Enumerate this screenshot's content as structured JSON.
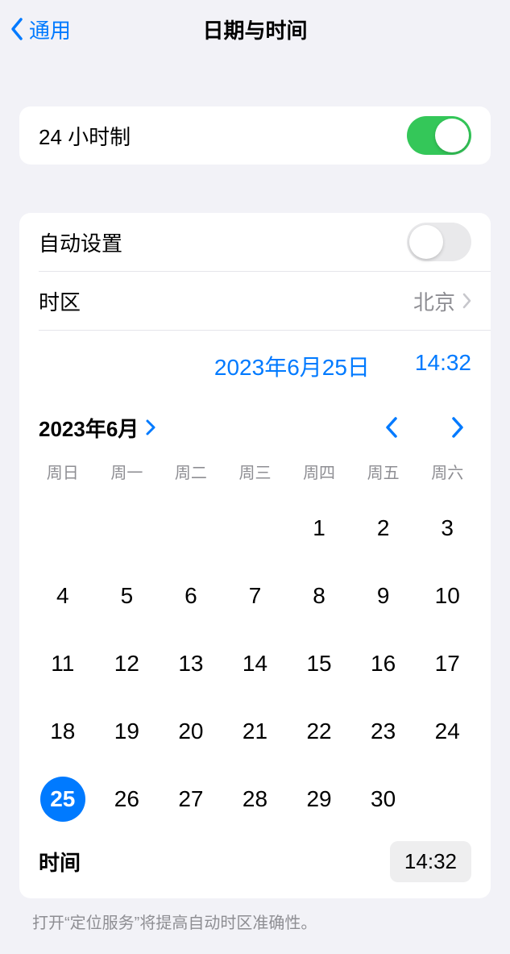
{
  "nav": {
    "back_label": "通用",
    "title": "日期与时间"
  },
  "settings": {
    "twenty_four_hour": {
      "label": "24 小时制",
      "enabled": true
    },
    "auto_set": {
      "label": "自动设置",
      "enabled": false
    },
    "timezone": {
      "label": "时区",
      "value": "北京"
    }
  },
  "picker": {
    "date_display": "2023年6月25日",
    "time_display": "14:32"
  },
  "calendar": {
    "month_label": "2023年6月",
    "weekdays": [
      "周日",
      "周一",
      "周二",
      "周三",
      "周四",
      "周五",
      "周六"
    ],
    "first_weekday_index": 4,
    "days_in_month": 30,
    "selected_day": 25
  },
  "time_row": {
    "label": "时间",
    "value": "14:32"
  },
  "footer": "打开“定位服务”将提高自动时区准确性。"
}
